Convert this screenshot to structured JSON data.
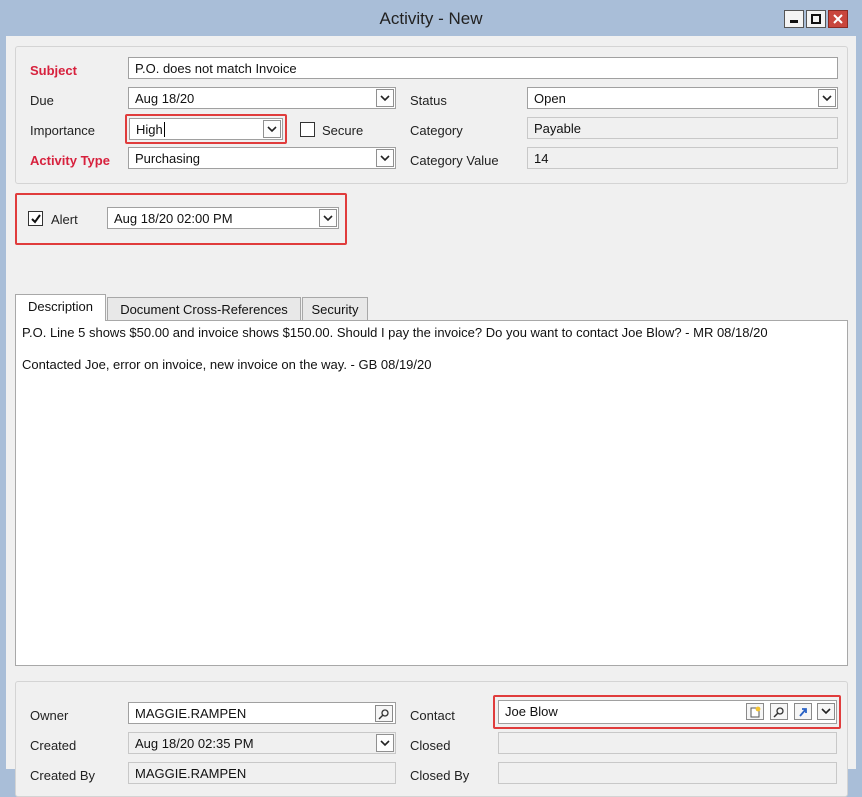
{
  "window": {
    "title": "Activity - New"
  },
  "form": {
    "subject": {
      "label": "Subject",
      "value": "P.O. does not match Invoice"
    },
    "due": {
      "label": "Due",
      "value": "Aug 18/20"
    },
    "status": {
      "label": "Status",
      "value": "Open"
    },
    "importance": {
      "label": "Importance",
      "value": "High"
    },
    "secure": {
      "label": "Secure",
      "checked": false
    },
    "category": {
      "label": "Category",
      "value": "Payable"
    },
    "activity_type": {
      "label": "Activity Type",
      "value": "Purchasing"
    },
    "category_value": {
      "label": "Category Value",
      "value": "14"
    }
  },
  "alert": {
    "label": "Alert",
    "checked": true,
    "value": "Aug 18/20 02:00 PM"
  },
  "tabs": [
    {
      "label": "Description",
      "active": true
    },
    {
      "label": "Document Cross-References",
      "active": false
    },
    {
      "label": "Security",
      "active": false
    }
  ],
  "description": {
    "lines": [
      "P.O. Line 5 shows $50.00 and invoice shows $150.00. Should I pay the invoice? Do you want to contact Joe Blow? - MR 08/18/20",
      "Contacted Joe, error on invoice, new invoice on the way. - GB 08/19/20"
    ]
  },
  "footer": {
    "owner": {
      "label": "Owner",
      "value": "MAGGIE.RAMPEN"
    },
    "contact": {
      "label": "Contact",
      "value": "Joe Blow"
    },
    "created": {
      "label": "Created",
      "value": "Aug 18/20 02:35 PM"
    },
    "closed": {
      "label": "Closed",
      "value": ""
    },
    "created_by": {
      "label": "Created By",
      "value": "MAGGIE.RAMPEN"
    },
    "closed_by": {
      "label": "Closed By",
      "value": ""
    }
  },
  "colors": {
    "required_label": "#d7213d",
    "highlight": "#e03c3c",
    "frame": "#a9bed8"
  },
  "icons": [
    "minimize-icon",
    "maximize-icon",
    "close-icon",
    "chevron-down-icon",
    "checkmark-icon",
    "lookup-icon",
    "new-contact-icon",
    "link-icon"
  ]
}
